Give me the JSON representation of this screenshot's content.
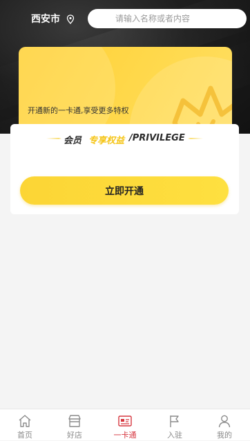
{
  "header": {
    "city": "西安市",
    "search": {
      "placeholder": "请输入名称或者内容",
      "value": ""
    }
  },
  "card": {
    "promo_text": "开通新的一卡通,享受更多特权"
  },
  "privilege": {
    "title_member": "会员",
    "title_exclusive": "专享权益",
    "title_english": "/PRIVILEGE",
    "open_button": "立即开通"
  },
  "tabbar": {
    "items": [
      {
        "label": "首页",
        "icon": "home-icon",
        "active": false
      },
      {
        "label": "好店",
        "icon": "store-icon",
        "active": false
      },
      {
        "label": "一卡通",
        "icon": "card-icon",
        "active": true
      },
      {
        "label": "入驻",
        "icon": "flag-icon",
        "active": false
      },
      {
        "label": "我的",
        "icon": "user-icon",
        "active": false
      }
    ]
  },
  "colors": {
    "accent_yellow": "#fcd535",
    "active_tab": "#d6363f",
    "inactive_tab": "#8a8a8a"
  }
}
